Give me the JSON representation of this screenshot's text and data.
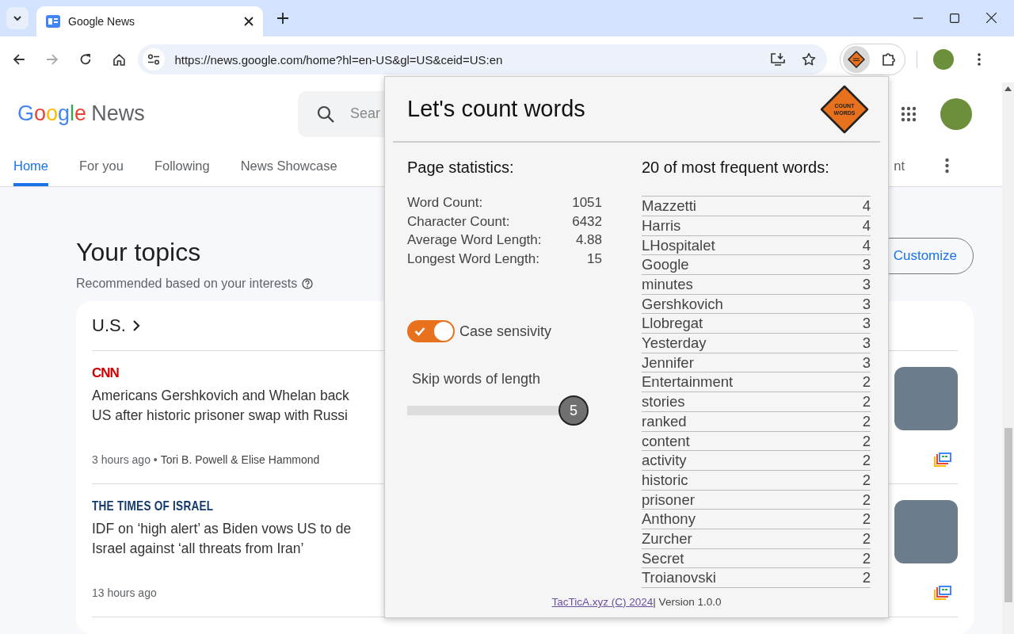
{
  "browser": {
    "tab_title": "Google News",
    "url": "https://news.google.com/home?hl=en-US&gl=US&ceid=US:en",
    "forward_disabled": true
  },
  "header": {
    "logo": "Google",
    "logo_suffix": "News",
    "search_placeholder": "Sear"
  },
  "nav_tabs": [
    {
      "label": "Home",
      "selected": true
    },
    {
      "label": "For you",
      "selected": false
    },
    {
      "label": "Following",
      "selected": false
    },
    {
      "label": "News Showcase",
      "selected": false
    },
    {
      "label": "nt",
      "selected": false
    }
  ],
  "topics": {
    "title": "Your topics",
    "subtitle": "Recommended based on your interests",
    "customize": "Customize"
  },
  "card": {
    "heading": "U.S.",
    "stories": [
      {
        "source": "CNN",
        "kind": "cnn",
        "headline_lines": [
          "Americans Gershkovich and Whelan back",
          "US after historic prisoner swap with Russi"
        ],
        "meta": "3 hours ago • **Tori B. Powell & Elise Hammond**"
      },
      {
        "source": "THE TIMES OF ISRAEL",
        "kind": "times",
        "headline_lines": [
          "IDF on ‘high alert’ as Biden vows US to de",
          "Israel against ‘all threats from Iran’"
        ],
        "meta": "13 hours ago"
      }
    ]
  },
  "popup": {
    "title": "Let's count words",
    "logo_lines": [
      "COUNT",
      "WORDS"
    ],
    "stats_heading": "Page statistics:",
    "stats": [
      {
        "label": "Word Count:",
        "value": "1051"
      },
      {
        "label": "Character Count:",
        "value": "6432"
      },
      {
        "label": "Average Word Length:",
        "value": "4.88"
      },
      {
        "label": "Longest Word Length:",
        "value": "15"
      }
    ],
    "case_sensitivity": {
      "label": "Case sensivity",
      "on": true
    },
    "skip": {
      "label": "Skip words of length",
      "value": "5",
      "level": 1
    },
    "words_heading": "20 of most frequent words:",
    "words": [
      {
        "word": "Mazzetti",
        "count": "4"
      },
      {
        "word": "Harris",
        "count": "4"
      },
      {
        "word": "LHospitalet",
        "count": "4"
      },
      {
        "word": "Google",
        "count": "3"
      },
      {
        "word": "minutes",
        "count": "3"
      },
      {
        "word": "Gershkovich",
        "count": "3"
      },
      {
        "word": "Llobregat",
        "count": "3"
      },
      {
        "word": "Yesterday",
        "count": "3"
      },
      {
        "word": "Jennifer",
        "count": "3"
      },
      {
        "word": "Entertainment",
        "count": "2"
      },
      {
        "word": "stories",
        "count": "2"
      },
      {
        "word": "ranked",
        "count": "2"
      },
      {
        "word": "content",
        "count": "2"
      },
      {
        "word": "activity",
        "count": "2"
      },
      {
        "word": "historic",
        "count": "2"
      },
      {
        "word": "prisoner",
        "count": "2"
      },
      {
        "word": "Anthony",
        "count": "2"
      },
      {
        "word": "Zurcher",
        "count": "2"
      },
      {
        "word": "Secret",
        "count": "2"
      },
      {
        "word": "Troianovski",
        "count": "2"
      }
    ],
    "footer_link": "TacTicA.xyz (C) 2024",
    "footer_text": "| Version 1.0.0"
  }
}
